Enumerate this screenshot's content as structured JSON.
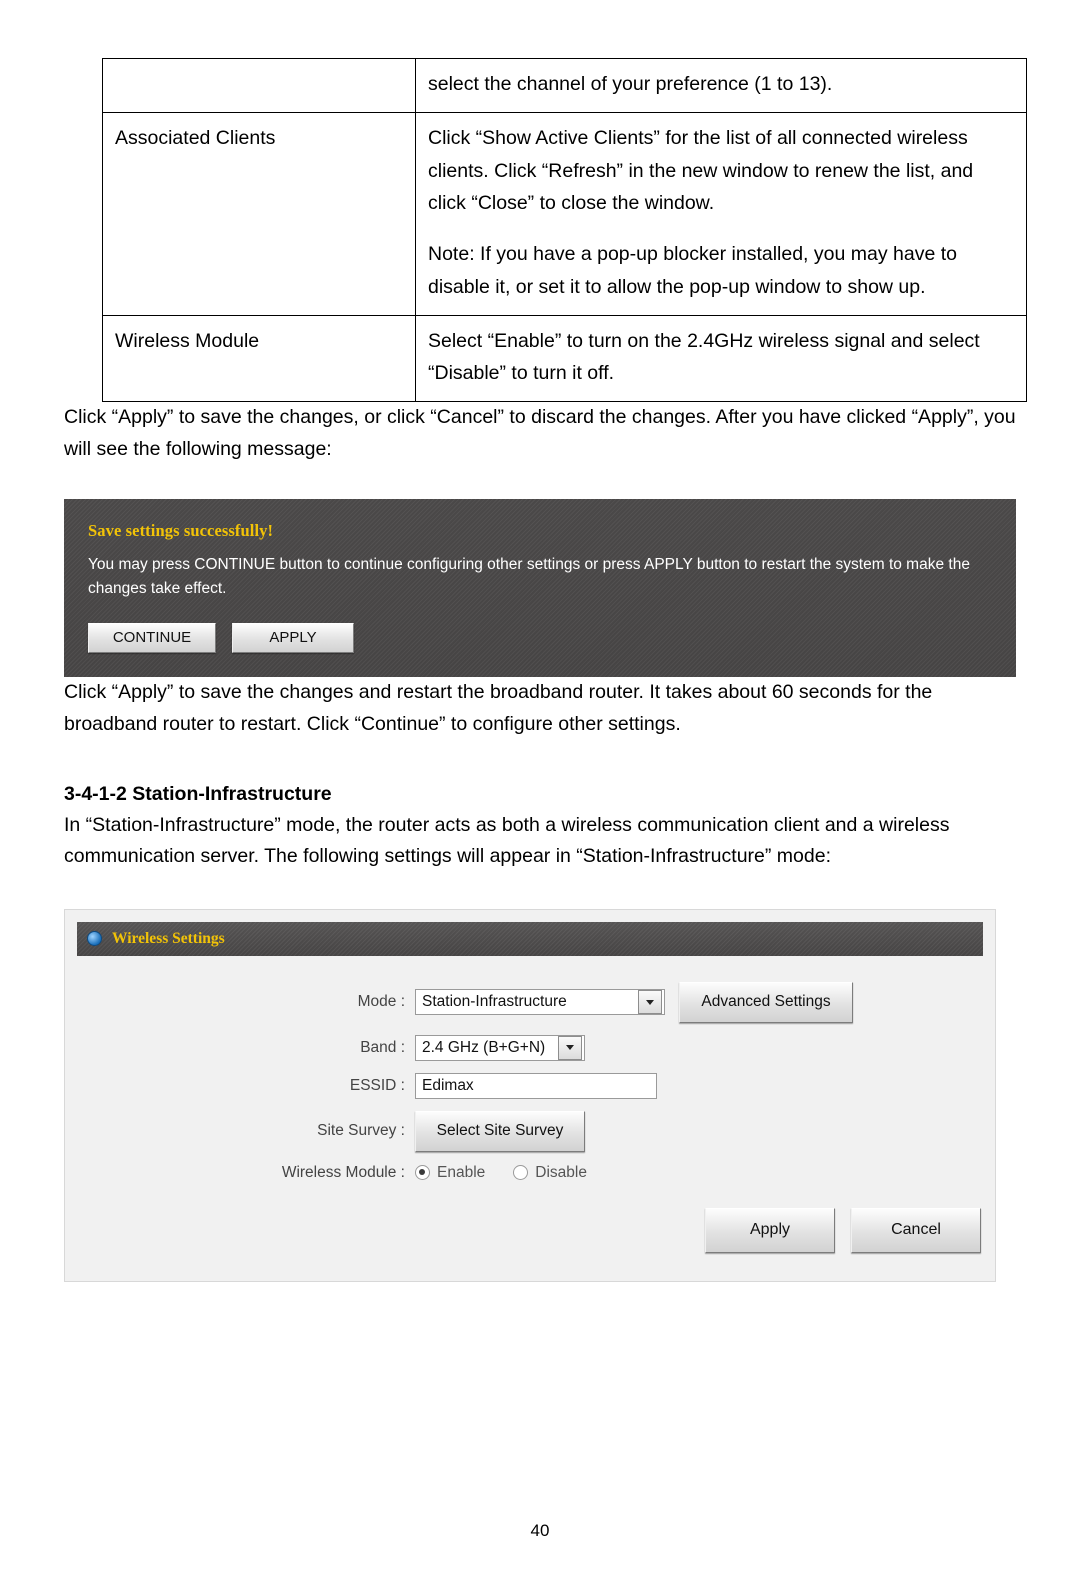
{
  "table": {
    "rows": [
      {
        "label": "",
        "desc": "select the channel of your preference (1 to 13)."
      },
      {
        "label": "Associated Clients",
        "desc": "Click “Show Active Clients” for the list of all connected wireless clients. Click “Refresh” in the new window to renew the list, and click “Close” to close the window.",
        "desc2": "Note: If you have a pop-up blocker installed, you may have to disable it, or set it to allow the pop-up window to show up."
      },
      {
        "label": "Wireless Module",
        "desc": "Select “Enable” to turn on the 2.4GHz wireless signal and select “Disable” to turn it off."
      }
    ]
  },
  "paragraphs": {
    "p1": "Click “Apply” to save the changes, or click “Cancel” to discard the changes. After you have clicked “Apply”, you will see the following message:",
    "p2": "Click “Apply” to save the changes and restart the broadband router. It takes about 60 seconds for the broadband router to restart. Click “Continue” to configure other settings.",
    "p3": "In “Station-Infrastructure” mode, the router acts as both a wireless communication client and a wireless communication server. The following settings will appear in “Station-Infrastructure” mode:"
  },
  "heading": "3-4-1-2 Station-Infrastructure",
  "save_panel": {
    "title": "Save settings successfully!",
    "message": "You may press CONTINUE button to continue configuring other settings or press APPLY button to restart the system to make the changes take effect.",
    "continue_label": "CONTINUE",
    "apply_label": "APPLY",
    "title_color": "#f2c307",
    "background": "#4b4949"
  },
  "wireless_panel": {
    "header_title": "Wireless Settings",
    "header_color": "#f2c307",
    "fields": {
      "mode_label": "Mode :",
      "mode_value": "Station-Infrastructure",
      "advanced_button": "Advanced Settings",
      "band_label": "Band :",
      "band_value": "2.4 GHz (B+G+N)",
      "essid_label": "ESSID :",
      "essid_value": "Edimax",
      "site_survey_label": "Site Survey :",
      "site_survey_button": "Select Site Survey",
      "wireless_module_label": "Wireless Module :",
      "enable_label": "Enable",
      "disable_label": "Disable",
      "apply_label": "Apply",
      "cancel_label": "Cancel"
    }
  },
  "page_number": "40"
}
